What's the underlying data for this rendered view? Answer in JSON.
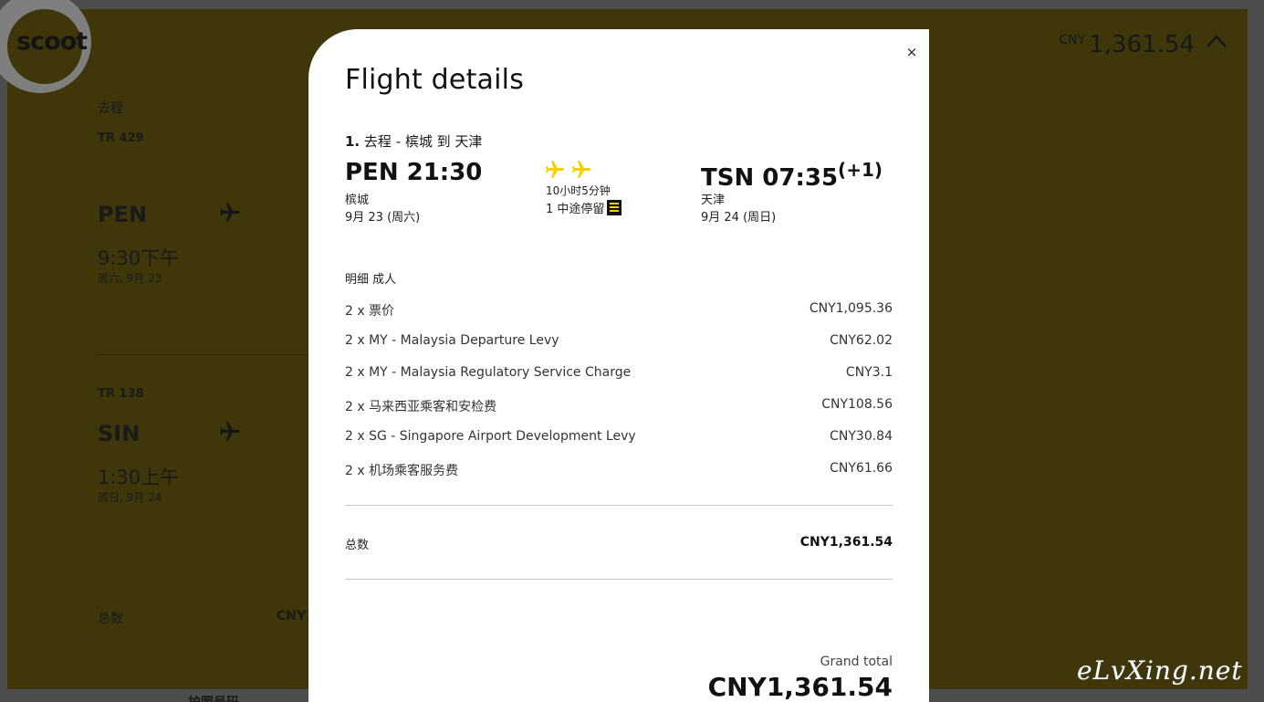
{
  "background": {
    "logo_text": "scoot",
    "price_currency": "CNY",
    "price_amount": "1,361.54",
    "direction_label": "去程",
    "leg1": {
      "flight_no": "TR 429",
      "code": "PEN",
      "time": "9:30下午",
      "date": "周六, 9月 23"
    },
    "leg2": {
      "flight_no": "TR 138",
      "code": "SIN",
      "time": "1:30上午",
      "date": "周日, 9月 24"
    },
    "total_label": "总数",
    "total_value_partial": "CNY1",
    "passport_label": "护照号码"
  },
  "modal": {
    "title": "Flight details",
    "close_symbol": "×",
    "segment_number": "1.",
    "segment_title": "去程 - 槟城 到 天津",
    "departure": {
      "code_time": "PEN 21:30",
      "city": "槟城",
      "date": "9月 23 (周六)"
    },
    "middle": {
      "duration": "10小时5分钟",
      "stops": "1 中途停留"
    },
    "arrival": {
      "code_time": "TSN 07:35",
      "day_offset": "(+1)",
      "city": "天津",
      "date": "9月 24 (周日)"
    },
    "breakdown_header": "明细 成人",
    "breakdown": [
      {
        "label": "2 x 票价",
        "value": "CNY1,095.36"
      },
      {
        "label": "2 x MY - Malaysia Departure Levy",
        "value": "CNY62.02"
      },
      {
        "label": "2 x MY - Malaysia Regulatory Service Charge",
        "value": "CNY3.1"
      },
      {
        "label": "2 x 马来西亚乘客和安检费",
        "value": "CNY108.56"
      },
      {
        "label": "2 x SG - Singapore Airport Development Levy",
        "value": "CNY30.84"
      },
      {
        "label": "2 x 机场乘客服务费",
        "value": "CNY61.66"
      }
    ],
    "total_label": "总数",
    "total_value": "CNY1,361.54",
    "grand_total_label": "Grand total",
    "grand_total_value": "CNY1,361.54"
  },
  "watermark": "eLvXing.net",
  "colors": {
    "brand_yellow": "#f5d000",
    "overlay_bg": "#3f3609"
  },
  "icons": [
    "plane-icon",
    "close-icon",
    "chevron-up-icon",
    "stopover-icon"
  ]
}
